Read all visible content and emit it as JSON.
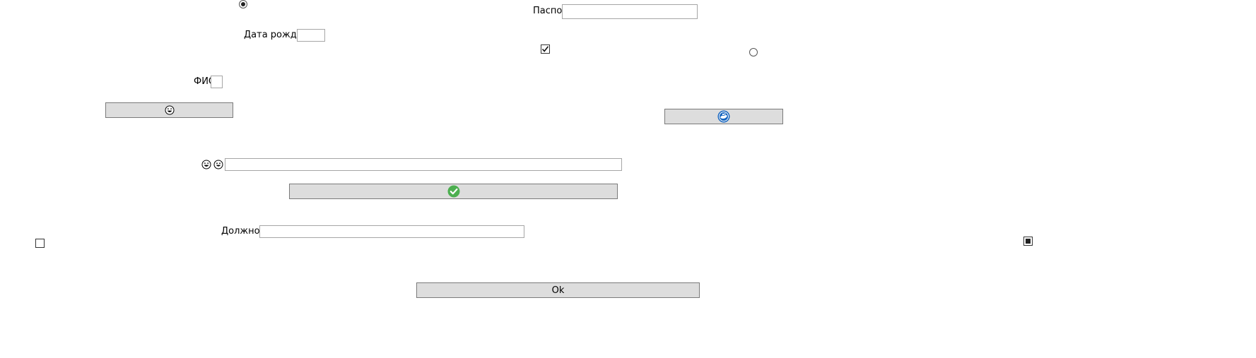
{
  "form": {
    "passport_label": "Паспорт",
    "passport_value": "",
    "birthdate_label": "Дата рождения",
    "birthdate_value": "",
    "fio_label": "ФИО",
    "fio_value": "",
    "position_label": "Должность",
    "position_value": "",
    "emoji_field_value": "",
    "ok_label": "Ok"
  },
  "controls": {
    "radio_top_checked": true,
    "radio_right_checked": false,
    "checkbox_mid_checked": true,
    "checkbox_left_checked": false,
    "checkbox_right_state": "indeterminate"
  },
  "icons": {
    "smile_button_icon": "laughing-face-icon",
    "emoji_field_icons": [
      "laughing-face-icon",
      "grinning-face-icon"
    ],
    "blue_button_icon": "blue-whale-badge-icon",
    "green_button_icon": "green-checkmark-icon"
  },
  "colors": {
    "button_bg": "#dddddd",
    "check_green": "#4caf50",
    "blue_badge": "#1565c0"
  }
}
